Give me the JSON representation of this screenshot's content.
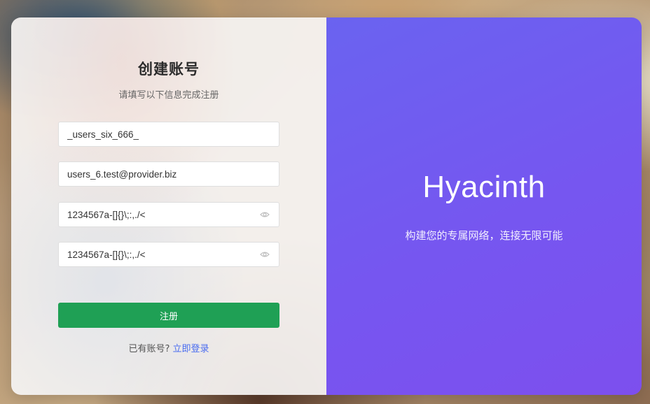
{
  "form": {
    "title": "创建账号",
    "subtitle": "请填写以下信息完成注册",
    "username_value": "_users_six_666_",
    "email_value": "users_6.test@provider.biz",
    "password_value": "1234567a-[]{}\\;:,./<",
    "confirm_password_value": "1234567a-[]{}\\;:,./<",
    "submit_label": "注册",
    "have_account_text": "已有账号?",
    "login_link_label": "立即登录"
  },
  "brand_panel": {
    "name": "Hyacinth",
    "tagline": "构建您的专属网络，连接无限可能"
  },
  "colors": {
    "accent_purple": "#7158f0",
    "submit_green": "#1fa055",
    "link_blue": "#4a6cf0"
  },
  "icons": {
    "password_toggle": "eye-icon"
  }
}
